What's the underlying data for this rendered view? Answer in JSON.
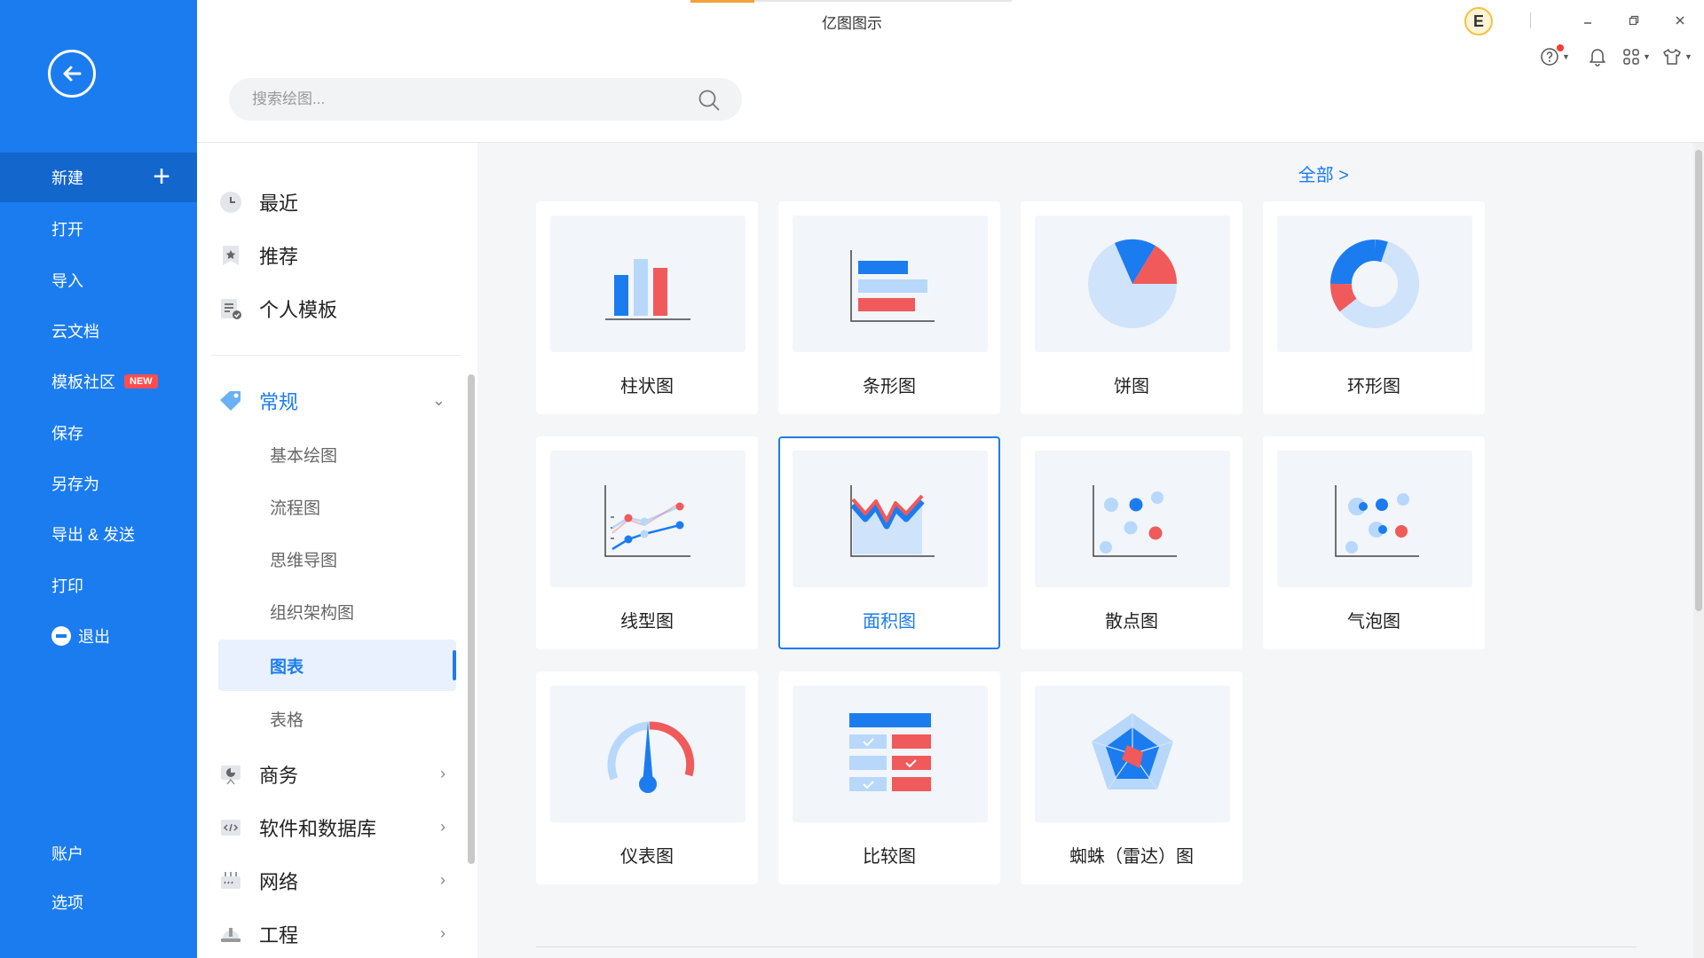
{
  "app": {
    "title": "亿图图示",
    "avatar_letter": "E"
  },
  "search": {
    "placeholder": "搜索绘图..."
  },
  "leftnav": {
    "items": [
      {
        "label": "新建"
      },
      {
        "label": "打开"
      },
      {
        "label": "导入"
      },
      {
        "label": "云文档"
      },
      {
        "label": "模板社区",
        "badge": "NEW"
      },
      {
        "label": "保存"
      },
      {
        "label": "另存为"
      },
      {
        "label": "导出 & 发送"
      },
      {
        "label": "打印"
      },
      {
        "label": "退出"
      },
      {
        "label": "账户"
      },
      {
        "label": "选项"
      }
    ]
  },
  "categories": {
    "top": [
      {
        "label": "最近"
      },
      {
        "label": "推荐"
      },
      {
        "label": "个人模板"
      }
    ],
    "general": {
      "label": "常规"
    },
    "sub": [
      {
        "label": "基本绘图"
      },
      {
        "label": "流程图"
      },
      {
        "label": "思维导图"
      },
      {
        "label": "组织架构图"
      },
      {
        "label": "图表"
      },
      {
        "label": "表格"
      }
    ],
    "more": [
      {
        "label": "商务"
      },
      {
        "label": "软件和数据库"
      },
      {
        "label": "网络"
      },
      {
        "label": "工程"
      }
    ]
  },
  "main": {
    "all_link": "全部 >",
    "cards": [
      {
        "label": "柱状图"
      },
      {
        "label": "条形图"
      },
      {
        "label": "饼图"
      },
      {
        "label": "环形图"
      },
      {
        "label": "线型图"
      },
      {
        "label": "面积图"
      },
      {
        "label": "散点图"
      },
      {
        "label": "气泡图"
      },
      {
        "label": "仪表图"
      },
      {
        "label": "比较图"
      },
      {
        "label": "蜘蛛（雷达）图"
      }
    ]
  },
  "colors": {
    "accent": "#1b7cf0",
    "red": "#f05a5a",
    "light_blue": "#b7d8fb"
  }
}
